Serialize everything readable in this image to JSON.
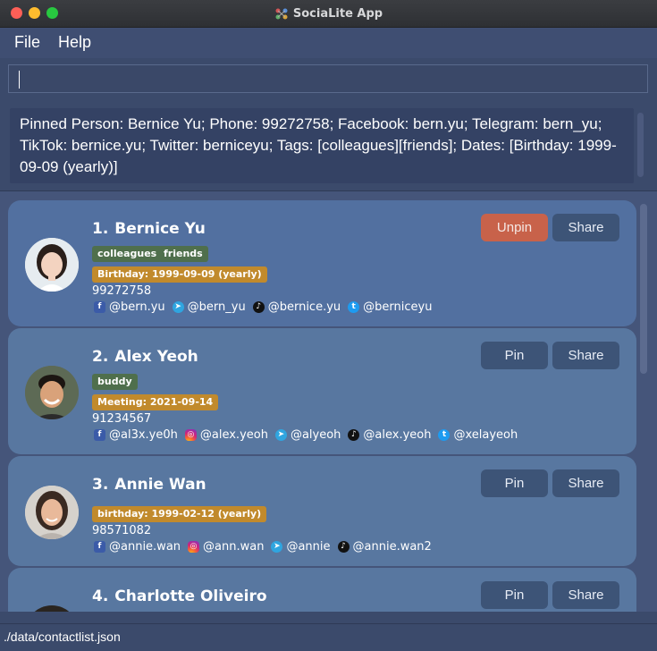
{
  "window": {
    "title": "SociaLite App"
  },
  "menu": {
    "file": "File",
    "help": "Help"
  },
  "command": {
    "value": ""
  },
  "result": {
    "text": "Pinned Person: Bernice Yu; Phone: 99272758; Facebook: bern.yu; Telegram: bern_yu; TikTok: bernice.yu; Twitter: berniceyu; Tags: [colleagues][friends]; Dates: [Birthday: 1999-09-09 (yearly)]"
  },
  "buttons": {
    "pin": "Pin",
    "unpin": "Unpin",
    "share": "Share"
  },
  "contacts": [
    {
      "index": "1.",
      "name": "Bernice Yu",
      "tags": [
        "colleagues",
        "friends"
      ],
      "date": "Birthday: 1999-09-09 (yearly)",
      "phone": "99272758",
      "socials": [
        {
          "icon": "facebook-icon",
          "handle": "@bern.yu"
        },
        {
          "icon": "telegram-icon",
          "handle": "@bern_yu"
        },
        {
          "icon": "tiktok-icon",
          "handle": "@bernice.yu"
        },
        {
          "icon": "twitter-icon",
          "handle": "@berniceyu"
        }
      ]
    },
    {
      "index": "2.",
      "name": "Alex Yeoh",
      "tags": [
        "buddy"
      ],
      "date": "Meeting: 2021-09-14",
      "phone": "91234567",
      "socials": [
        {
          "icon": "facebook-icon",
          "handle": "@al3x.ye0h"
        },
        {
          "icon": "instagram-icon",
          "handle": "@alex.yeoh"
        },
        {
          "icon": "telegram-icon",
          "handle": "@alyeoh"
        },
        {
          "icon": "tiktok-icon",
          "handle": "@alex.yeoh"
        },
        {
          "icon": "twitter-icon",
          "handle": "@xelayeoh"
        }
      ]
    },
    {
      "index": "3.",
      "name": "Annie Wan",
      "tags": [],
      "date": "birthday: 1999-02-12 (yearly)",
      "phone": "98571082",
      "socials": [
        {
          "icon": "facebook-icon",
          "handle": "@annie.wan"
        },
        {
          "icon": "instagram-icon",
          "handle": "@ann.wan"
        },
        {
          "icon": "telegram-icon",
          "handle": "@annie"
        },
        {
          "icon": "tiktok-icon",
          "handle": "@annie.wan2"
        }
      ]
    },
    {
      "index": "4.",
      "name": "Charlotte Oliveiro"
    }
  ],
  "status": {
    "path": "./data/contactlist.json"
  },
  "colors": {
    "unpin": "#c8624a",
    "tag": "#4f6f4c",
    "date": "#c18a2c",
    "card": "#5877a0"
  }
}
